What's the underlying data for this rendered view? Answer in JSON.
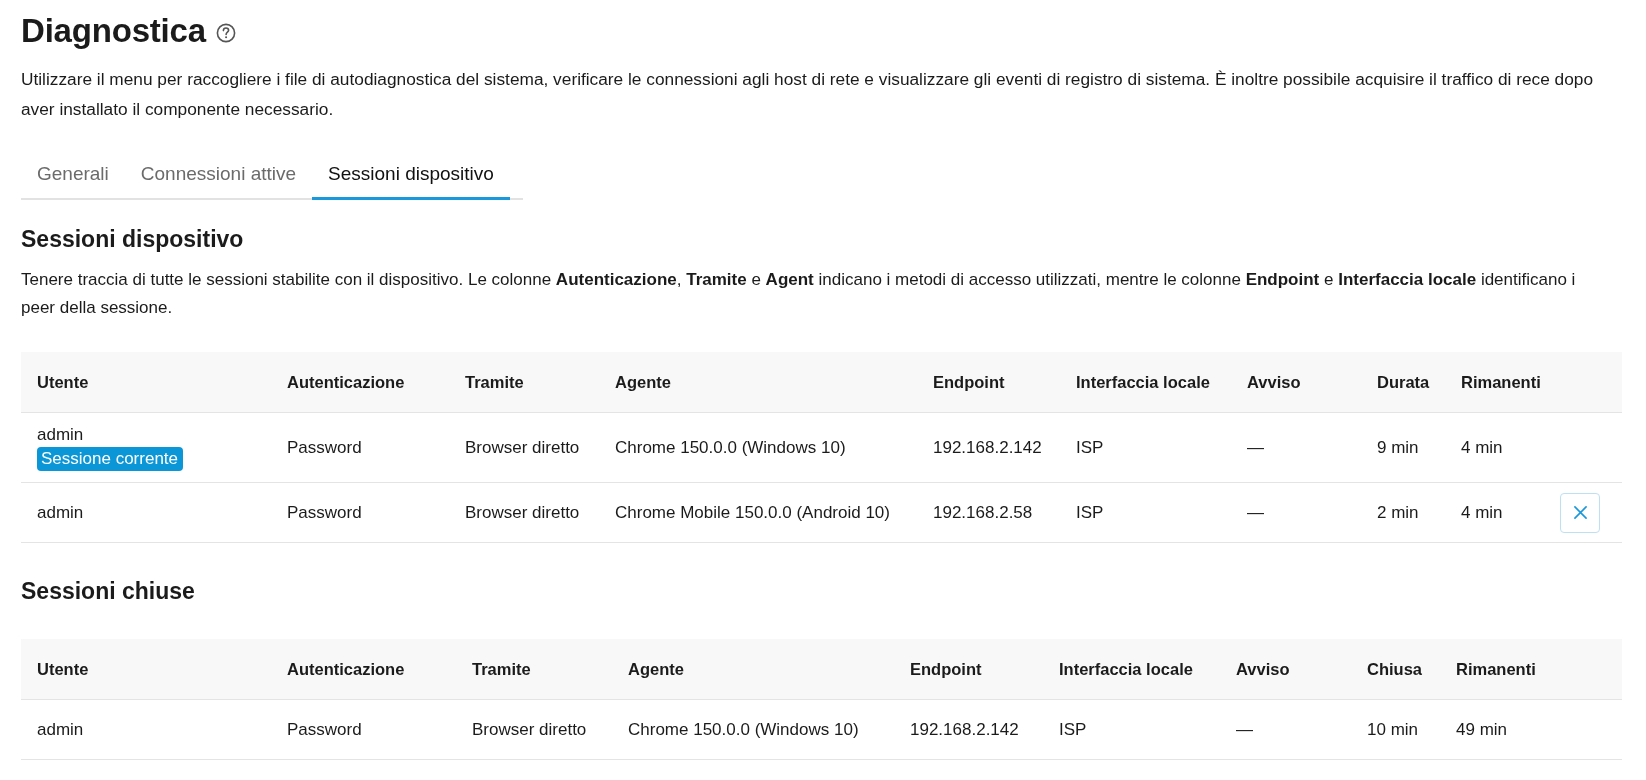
{
  "page": {
    "title": "Diagnostica",
    "description": "Utilizzare il menu per raccogliere i file di autodiagnostica del sistema, verificare le connessioni agli host di rete e visualizzare gli eventi di registro di sistema. È inoltre possibile acquisire il traffico di rece dopo aver installato il componente necessario."
  },
  "tabs": [
    {
      "label": "Generali",
      "selected": false
    },
    {
      "label": "Connessioni attive",
      "selected": false
    },
    {
      "label": "Sessioni dispositivo",
      "selected": true
    }
  ],
  "sections": [
    {
      "heading": "Sessioni dispositivo",
      "description": "Tenere traccia di tutte le sessioni stabilite con il dispositivo. Le colonne **Autenticazione**, **Tramite** e **Agent** indicano i metodi di accesso utilizzati, mentre le colonne **Endpoint** e **Interfaccia locale** identificano i peer della sessione.",
      "table": {
        "columns": [
          "Utente",
          "Autenticazione",
          "Tramite",
          "Agente",
          "Endpoint",
          "Interfaccia locale",
          "Avviso",
          "Durata",
          "Rimanenti"
        ],
        "rows": [
          {
            "cells": [
              "admin",
              "Password",
              "Browser diretto",
              "Chrome 150.0.0 (Windows 10)",
              "192.168.2.142",
              "ISP",
              "—",
              "9 min",
              "4 min"
            ],
            "badge": "Sessione corrente",
            "closable": false
          },
          {
            "cells": [
              "admin",
              "Password",
              "Browser diretto",
              "Chrome Mobile 150.0.0 (Android 10)",
              "192.168.2.58",
              "ISP",
              "—",
              "2 min",
              "4 min"
            ],
            "closable": true
          }
        ]
      }
    },
    {
      "heading": "Sessioni chiuse",
      "table": {
        "columns": [
          "Utente",
          "Autenticazione",
          "Tramite",
          "Agente",
          "Endpoint",
          "Interfaccia locale",
          "Avviso",
          "Chiusa",
          "Rimanenti"
        ],
        "rows": [
          {
            "cells": [
              "admin",
              "Password",
              "Browser diretto",
              "Chrome 150.0.0 (Windows 10)",
              "192.168.2.142",
              "ISP",
              "—",
              "10 min",
              "49 min"
            ]
          }
        ]
      }
    }
  ]
}
